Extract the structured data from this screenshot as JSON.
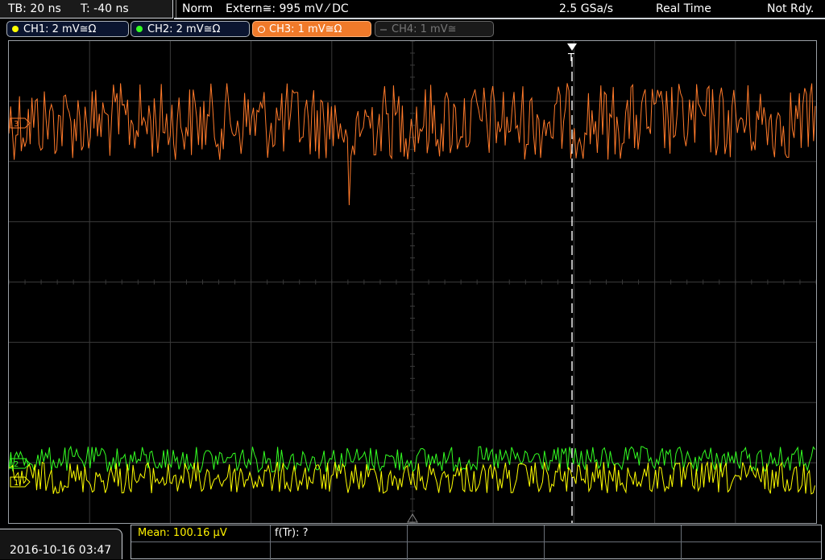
{
  "topbar": {
    "timebase": "TB: 20 ns",
    "trigger_time": "T: -40 ns",
    "mode": "Norm",
    "trigger_source": "Extern≅: 995 mV ⁄ DC",
    "sample_rate": "2.5 GSa/s",
    "acquisition": "Real Time",
    "status": "Not Rdy."
  },
  "channels": [
    {
      "label": "CH1: 2 mV≅Ω",
      "color": "#ffff00"
    },
    {
      "label": "CH2: 2 mV≅Ω",
      "color": "#39ff14"
    },
    {
      "label": "CH3: 1 mV≅Ω",
      "color": "#f07a2a"
    },
    {
      "label": "CH4: 1 mV≅",
      "color": "#555555"
    }
  ],
  "colors": {
    "ch1": "#ffff00",
    "ch2": "#33ff22",
    "ch3": "#ff7a2a",
    "grid": "#3a3a3a",
    "trigger_marker": "#ffffff"
  },
  "markers": {
    "trigger": "T",
    "ch3_ref": "3",
    "ch2_ref": "2",
    "ch1_ref": "1"
  },
  "measurements": {
    "mean": "Mean: 100.16 µV",
    "frequency": "f(Tr): ?"
  },
  "datetime": "2016-10-16 03:47"
}
